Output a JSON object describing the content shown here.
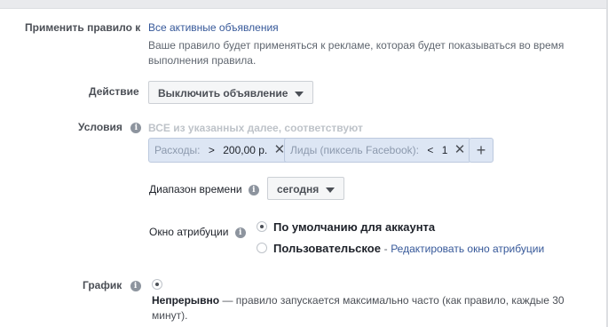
{
  "apply": {
    "label": "Применить правило к",
    "value": "Все активные объявления",
    "note": "Ваше правило будет применяться к рекламе, которая будет показываться во время выполнения правила."
  },
  "action": {
    "label": "Действие",
    "button": "Выключить объявление"
  },
  "conditions": {
    "label": "Условия",
    "hint": "ВСЕ из указанных далее, соответствуют",
    "tokens": [
      {
        "label": "Расходы:",
        "op": ">",
        "value": "200,00 р."
      },
      {
        "label": "Лиды (пиксель Facebook):",
        "op": "<",
        "value": "1"
      }
    ],
    "add_label": "+"
  },
  "time_range": {
    "label": "Диапазон времени",
    "button": "сегодня"
  },
  "attribution": {
    "label": "Окно атрибуции",
    "default_option": "По умолчанию для аккаунта",
    "custom_option": "Пользовательское",
    "edit_link": "Редактировать окно атрибуции"
  },
  "schedule": {
    "label": "График",
    "option_title": "Непрерывно",
    "option_desc": "— правило запускается максимально часто (как правило, каждые 30 минут)."
  },
  "icons": {
    "info": "info-icon",
    "caret": "caret-down-icon",
    "remove": "close-icon"
  }
}
